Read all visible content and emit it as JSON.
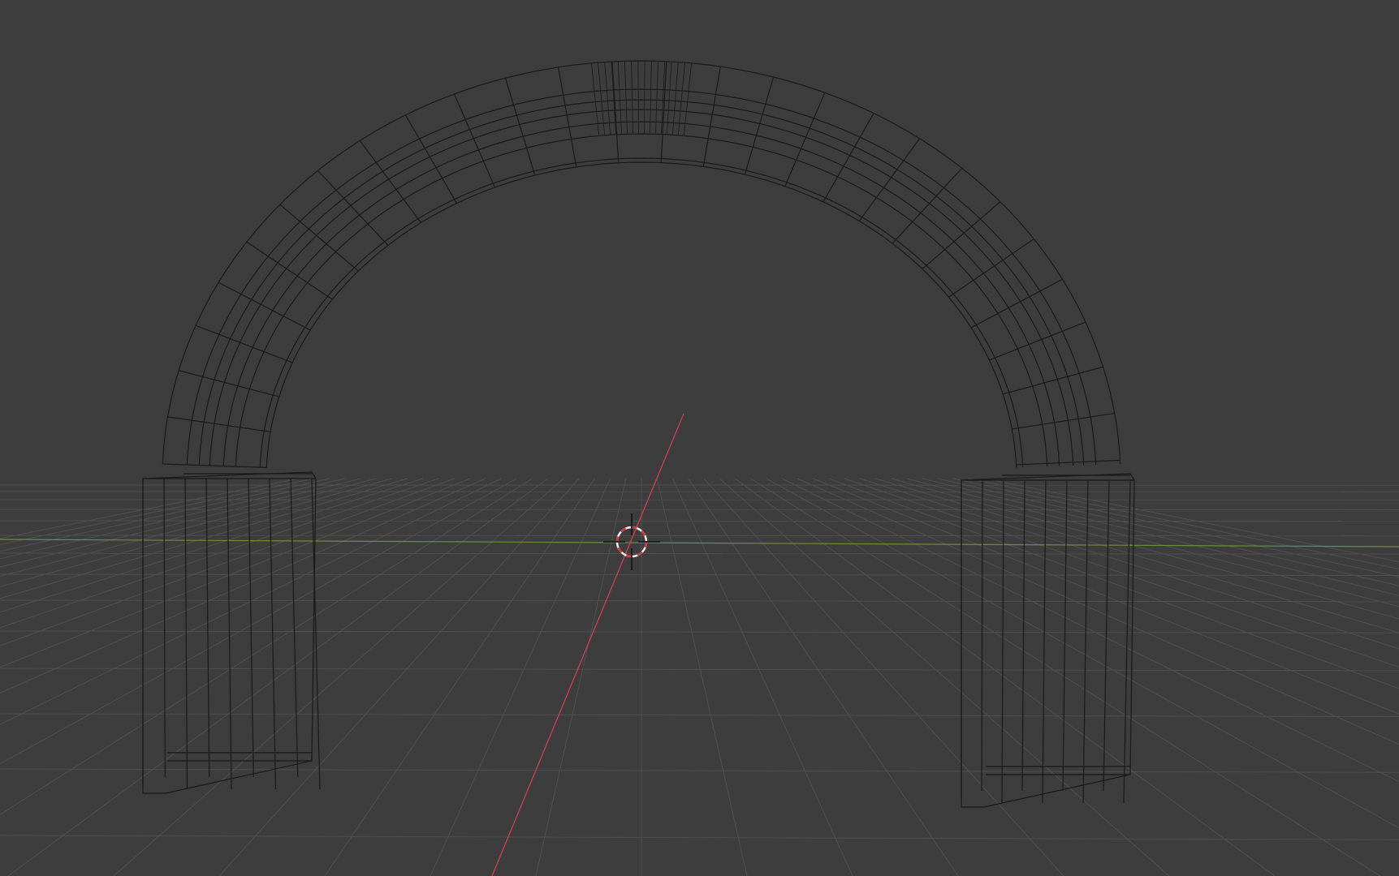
{
  "app": {
    "view": "3D Viewport",
    "display_mode": "wireframe"
  },
  "colors": {
    "background": "#3d3d3d",
    "grid_line": "#505050",
    "x_axis": "#c8404f",
    "y_axis": "#6a8f3a",
    "wire": "#1a1a1a",
    "cursor_red": "#d23a3a",
    "cursor_white": "#f0f0f0"
  },
  "scene": {
    "object": "arch",
    "icons": [
      "3d-cursor-icon"
    ]
  }
}
